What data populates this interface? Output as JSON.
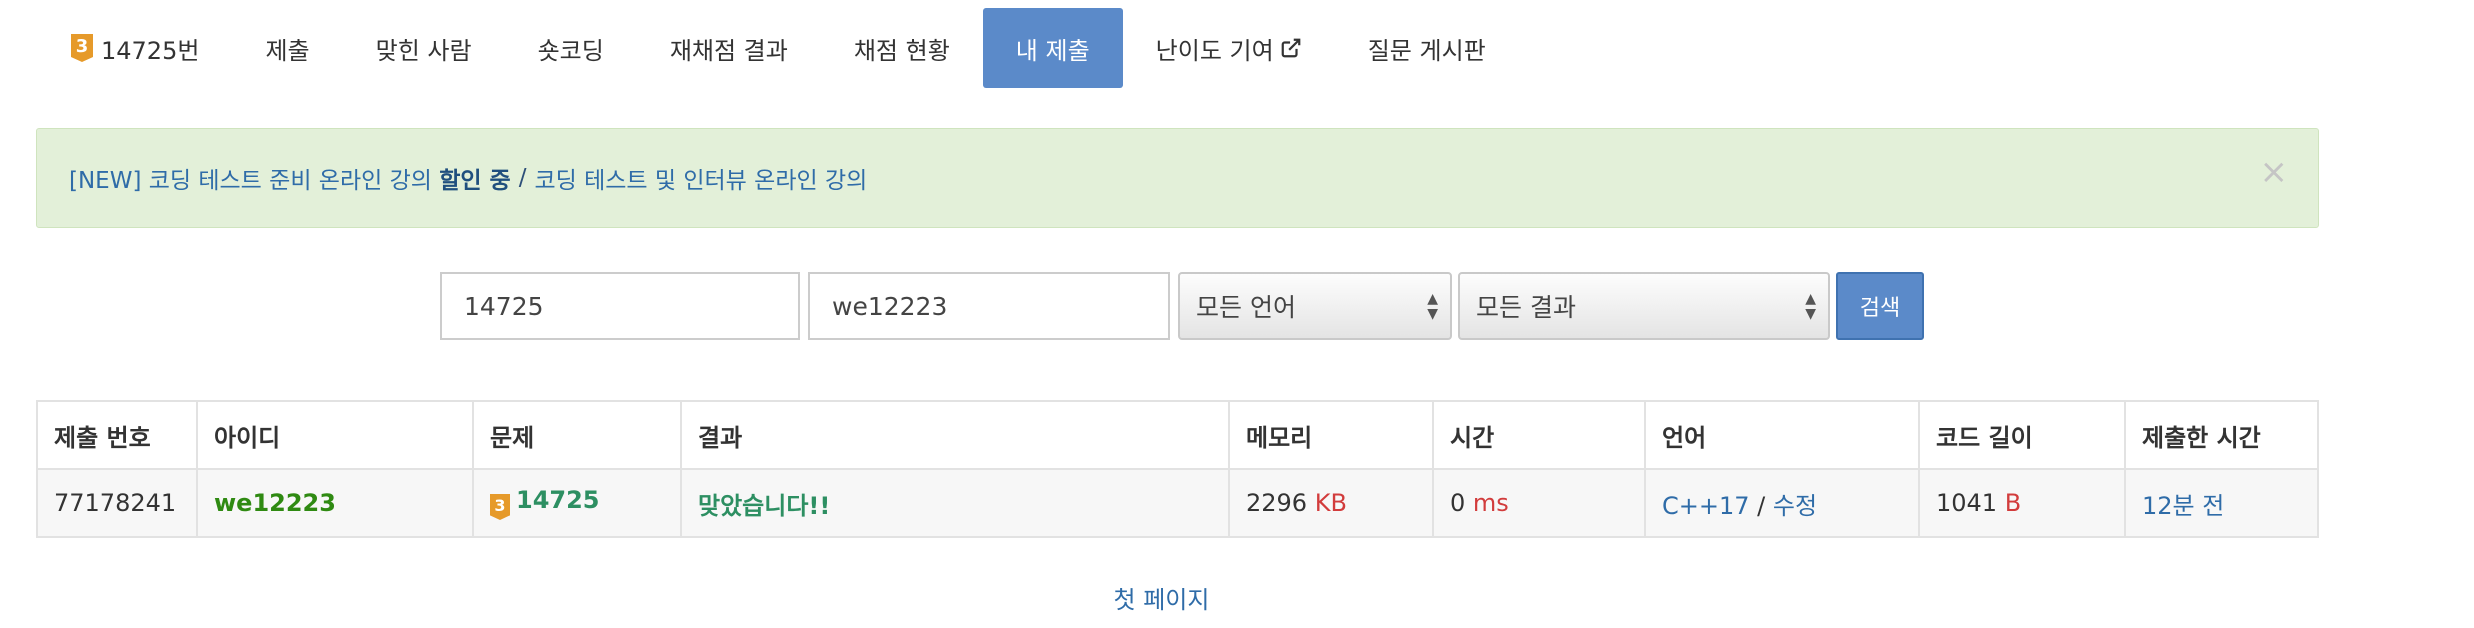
{
  "tabs": {
    "problem": {
      "tier": "3",
      "label": "14725번"
    },
    "submit": "제출",
    "solvers": "맞힌 사람",
    "shortcoding": "숏코딩",
    "rejudge": "재채점 결과",
    "status": "채점 현황",
    "my_submissions": "내 제출",
    "difficulty": "난이도 기여",
    "board": "질문 게시판"
  },
  "alert": {
    "link1_prefix": "[NEW] 코딩 테스트 준비 온라인 강의 ",
    "link1_bold": "할인 중",
    "separator": "/",
    "link2": "코딩 테스트 및 인터뷰 온라인 강의",
    "close": "×"
  },
  "search": {
    "problem_id": "14725",
    "user_id": "we12223",
    "language": "모든 언어",
    "result": "모든 결과",
    "button": "검색"
  },
  "table": {
    "headers": [
      "제출 번호",
      "아이디",
      "문제",
      "결과",
      "메모리",
      "시간",
      "언어",
      "코드 길이",
      "제출한 시간"
    ],
    "rows": [
      {
        "submission_id": "77178241",
        "user": "we12223",
        "tier": "3",
        "problem": "14725",
        "result": "맞았습니다!!",
        "memory": "2296",
        "memory_unit": "KB",
        "time": "0",
        "time_unit": "ms",
        "language": "C++17",
        "lang_sep": "/",
        "edit": "수정",
        "code_length": "1041",
        "code_unit": "B",
        "submitted": "12분 전"
      }
    ]
  },
  "pager": {
    "first_page": "첫 페이지"
  },
  "colors": {
    "accent": "#5b8ac9",
    "alert_bg": "#e3f0d9",
    "link": "#2f6ca8",
    "success": "#2d8f62",
    "tier_gold": "#e69a2a"
  }
}
